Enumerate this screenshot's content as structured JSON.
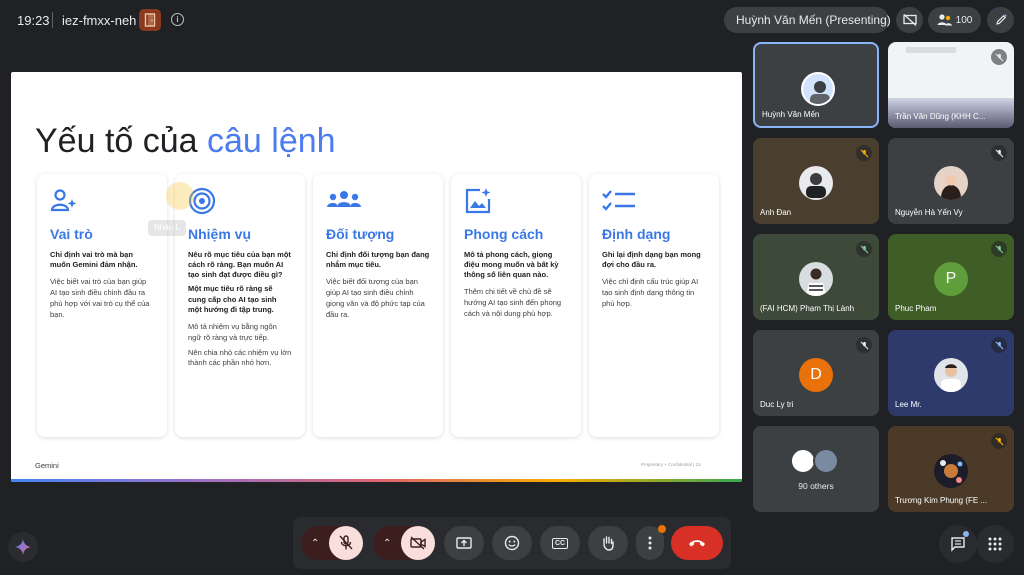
{
  "topbar": {
    "time": "19:23",
    "meeting_code": "iez-fmxx-neh",
    "presenter_chip": "Huỳnh Văn Mến (Presenting)",
    "people_count": "100",
    "icons": [
      "door-icon",
      "info-icon",
      "presentation-off-icon",
      "people-icon",
      "edit-icon"
    ]
  },
  "slide": {
    "title_part1": "Yếu tố của ",
    "title_part2": "câu lệnh",
    "title_accent_color": "#4d7cf0",
    "overlay_name": "Nhân L",
    "cards": [
      {
        "icon": "person-sparkle-icon",
        "heading": "Vai trò",
        "lead": "Chỉ định vai trò mà bạn muốn Gemini đảm nhận.",
        "body": [
          "Việc biết vai trò của bạn giúp AI tạo sinh điều chỉnh đầu ra phù hợp với vai trò cụ thể của bạn."
        ]
      },
      {
        "icon": "target-icon",
        "heading": "Nhiệm vụ",
        "lead": "Nêu rõ mục tiêu của bạn một cách rõ ràng. Bạn muốn AI tạo sinh đạt được điều gì?",
        "lead2": "Một mục tiêu rõ ràng sẽ cung cấp cho AI tạo sinh một hướng đi tập trung.",
        "body": [
          "Mô tả nhiệm vụ bằng ngôn ngữ rõ ràng và trực tiếp.",
          "Nên chia nhỏ các nhiệm vụ lớn thành các phần nhỏ hơn."
        ]
      },
      {
        "icon": "group-icon",
        "heading": "Đối tượng",
        "lead": "Chỉ định đối tượng bạn đang nhắm mục tiêu.",
        "body": [
          "Việc biết đối tượng của bạn giúp AI tạo sinh điều chỉnh giọng văn và độ phức tạp của đầu ra."
        ]
      },
      {
        "icon": "image-sparkle-icon",
        "heading": "Phong cách",
        "lead": "Mô tả phong cách, giọng điệu mong muốn và bất kỳ thông số liên quan nào.",
        "body": [
          "Thêm chi tiết về chủ đề sẽ hướng AI tạo sinh đến phong cách và nội dung phù hợp."
        ]
      },
      {
        "icon": "checklist-icon",
        "heading": "Định dạng",
        "lead": "Ghi lại định dạng bạn mong đợi cho đầu ra.",
        "body": [
          "Việc chỉ định cấu trúc giúp AI tạo sinh định dạng thông tin phù hợp."
        ]
      }
    ],
    "footer_left": "Gemini",
    "footer_right": "Proprietary + Confidential  |  15"
  },
  "participants": [
    {
      "name": "Huỳnh Văn Mến",
      "kind": "photo",
      "active": true
    },
    {
      "name": "Trần Văn Dũng (KHH C...",
      "kind": "screen",
      "muted": true
    },
    {
      "name": "Anh Đan",
      "kind": "photo",
      "muted": true
    },
    {
      "name": "Nguyễn Hà Yến Vy",
      "kind": "photo",
      "muted": true
    },
    {
      "name": "(FAI HCM) Phạm Thị Lành",
      "kind": "photo",
      "muted": true
    },
    {
      "name": "Phuc Pham",
      "kind": "letter",
      "letter": "P",
      "color": "#5f9e3a",
      "muted": true
    },
    {
      "name": "Duc Ly tri",
      "kind": "letter",
      "letter": "D",
      "color": "#e8710a",
      "muted": true
    },
    {
      "name": "Lee Mr.",
      "kind": "photo",
      "muted": true
    },
    {
      "name": "90 others",
      "kind": "others"
    },
    {
      "name": "Trương Kim Phụng (FE ...",
      "kind": "photo",
      "muted": true
    }
  ],
  "controls": {
    "mic": "mic-off-icon",
    "camera": "videocam-off-icon",
    "present": "present-icon",
    "emoji": "emoji-icon",
    "captions": "CC",
    "hand": "hand-icon",
    "more": "more-vert-icon",
    "leave": "call-end-icon",
    "chat": "chat-icon",
    "activities": "apps-icon",
    "gemini": "gemini-icon"
  },
  "colors": {
    "bg": "#202124",
    "tile": "#3c4043",
    "danger": "#f9dedc",
    "leave": "#d93025",
    "accent_blue": "#3b78e7"
  }
}
